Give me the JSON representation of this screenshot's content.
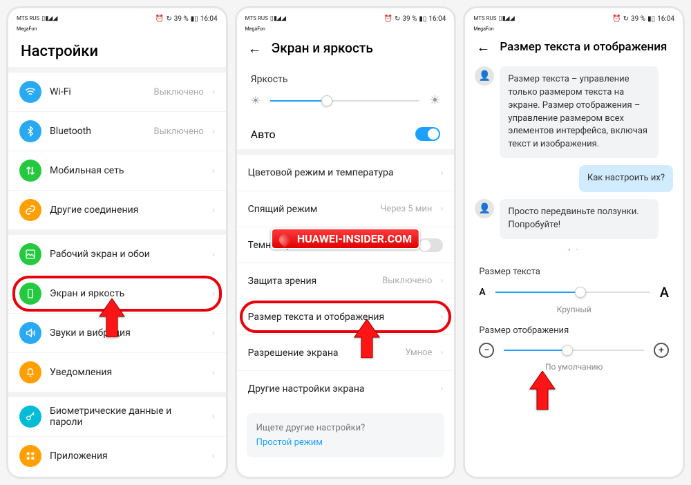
{
  "statusbar": {
    "carrier": "MTS RUS",
    "sub_carrier": "MegaFon",
    "battery_text": "39 %",
    "time": "16:04"
  },
  "screen1": {
    "title": "Настройки",
    "items": [
      {
        "label": "Wi-Fi",
        "value": "Выключено"
      },
      {
        "label": "Bluetooth",
        "value": "Выключено"
      },
      {
        "label": "Мобильная сеть",
        "value": ""
      },
      {
        "label": "Другие соединения",
        "value": ""
      },
      {
        "label": "Рабочий экран и обои",
        "value": ""
      },
      {
        "label": "Экран и яркость",
        "value": ""
      },
      {
        "label": "Звуки и вибрация",
        "value": ""
      },
      {
        "label": "Уведомления",
        "value": ""
      },
      {
        "label": "Биометрические данные и пароли",
        "value": ""
      },
      {
        "label": "Приложения",
        "value": ""
      }
    ]
  },
  "screen2": {
    "title": "Экран и яркость",
    "brightness_label": "Яркость",
    "auto_label": "Авто",
    "brightness_pct": 38,
    "items": [
      {
        "label": "Цветовой режим и температура",
        "value": ""
      },
      {
        "label": "Спящий режим",
        "value": "Через 5 мин"
      },
      {
        "label": "Темный режим",
        "value": ""
      },
      {
        "label": "Защита зрения",
        "value": "Выключено"
      },
      {
        "label": "Размер текста и отображения",
        "value": ""
      },
      {
        "label": "Разрешение экрана",
        "value": "Умное"
      },
      {
        "label": "Другие настройки экрана",
        "value": ""
      }
    ],
    "hint_q": "Ищете другие настройки?",
    "hint_link": "Простой режим"
  },
  "screen3": {
    "title": "Размер текста и отображения",
    "bubble1": "Размер текста – управление только размером текста на экране. Размер отображения – управление размером всех элементов интерфейса, включая текст и изображения.",
    "bubble2": "Как настроить их?",
    "bubble3": "Просто передвиньте ползунки. Попробуйте!",
    "text_size_label": "Размер текста",
    "text_size_value": "Крупный",
    "text_size_pct": 55,
    "display_size_label": "Размер отображения",
    "display_size_value": "По умолчанию",
    "display_size_pct": 45
  },
  "watermark_text": "HUAWEI-INSIDER.COM"
}
